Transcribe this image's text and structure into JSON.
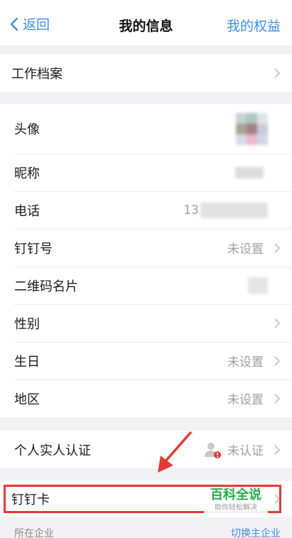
{
  "navbar": {
    "back_label": "返回",
    "title": "我的信息",
    "right_label": "我的权益"
  },
  "group1": {
    "work_profile": "工作档案"
  },
  "group2": {
    "avatar_label": "头像",
    "nickname_label": "昵称",
    "phone_label": "电话",
    "phone_value_prefix": "13",
    "dingtalk_id_label": "钉钉号",
    "dingtalk_id_value": "未设置",
    "qr_card_label": "二维码名片",
    "gender_label": "性别",
    "birthday_label": "生日",
    "birthday_value": "未设置",
    "region_label": "地区",
    "region_value": "未设置"
  },
  "group3": {
    "verify_label": "个人实人认证",
    "verify_value": "未认证"
  },
  "group4": {
    "card_label": "钉钉卡"
  },
  "bottom": {
    "company_label": "所在企业",
    "switch_label": "切换主企业"
  },
  "watermark": {
    "main": "百科全说",
    "sub": "助你轻松解决"
  },
  "colors": {
    "accent": "#3d8ef0",
    "highlight": "#e53935",
    "watermark_green": "#21b04b"
  }
}
